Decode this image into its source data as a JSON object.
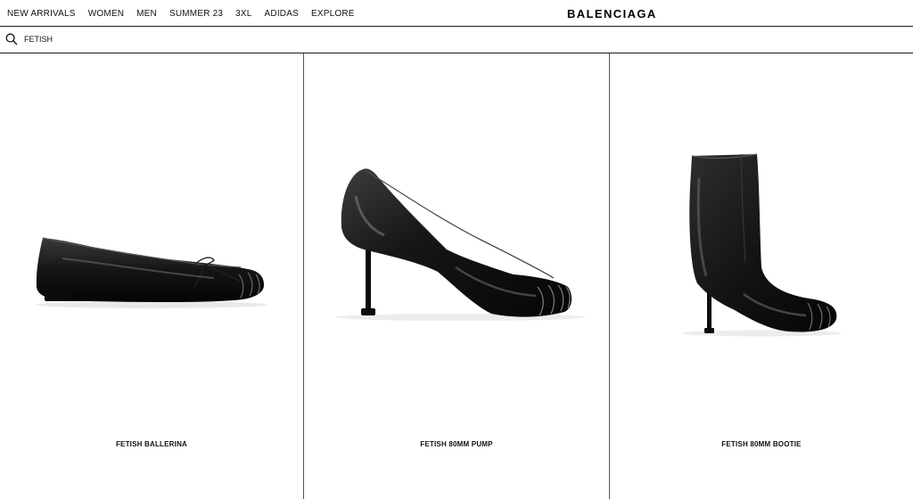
{
  "nav": {
    "items": [
      "NEW ARRIVALS",
      "WOMEN",
      "MEN",
      "SUMMER 23",
      "3XL",
      "ADIDAS",
      "EXPLORE"
    ]
  },
  "brand": {
    "logo_text": "BALENCIAGA"
  },
  "search": {
    "icon": "search-icon",
    "value": "FETISH"
  },
  "products": [
    {
      "name": "FETISH BALLERINA"
    },
    {
      "name": "FETISH 80MM PUMP"
    },
    {
      "name": "FETISH 80MM BOOTIE"
    }
  ],
  "colors": {
    "text": "#111111",
    "background": "#ffffff",
    "shoe": "#111111"
  }
}
